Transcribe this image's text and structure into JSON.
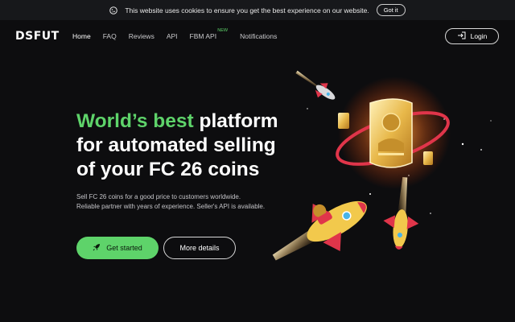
{
  "cookie": {
    "message": "This website uses cookies to ensure you get the best experience on our website.",
    "button": "Got it"
  },
  "nav": {
    "logo": "DSFUT",
    "items": [
      {
        "label": "Home",
        "active": true
      },
      {
        "label": "FAQ"
      },
      {
        "label": "Reviews"
      },
      {
        "label": "API"
      },
      {
        "label": "FBM API",
        "badge": "NEW"
      },
      {
        "label": "Notifications"
      }
    ],
    "login": "Login"
  },
  "hero": {
    "headline_green": "World’s best",
    "headline_rest_1": " platform",
    "headline_line2": "for automated selling",
    "headline_line3": "of your FC 26 coins",
    "subtext": "Sell FC 26 coins for a good price to customers worldwide. Reliable partner with years of experience. Seller's API is available.",
    "cta_primary": "Get started",
    "cta_secondary": "More details"
  },
  "colors": {
    "background": "#0d0d0f",
    "accent_green": "#5ed36a",
    "cookie_bar": "#17181b"
  },
  "icons": {
    "cookie": "cookie-icon",
    "login": "login-arrow-icon",
    "rocket": "rocket-icon"
  }
}
